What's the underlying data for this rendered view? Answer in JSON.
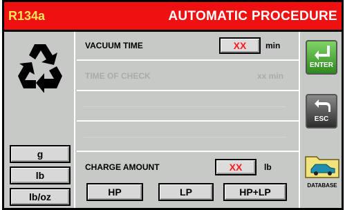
{
  "header": {
    "refrigerant": "R134a",
    "title": "AUTOMATIC PROCEDURE"
  },
  "units": [
    "g",
    "lb",
    "lb/oz"
  ],
  "rows": {
    "vacuum": {
      "label": "VACUUM TIME",
      "value": "XX",
      "unit": "min"
    },
    "check": {
      "label": "TIME OF CHECK",
      "value": "xx min"
    },
    "charge": {
      "label": "CHARGE AMOUNT",
      "value": "XX",
      "unit": "lb"
    }
  },
  "modes": [
    "HP",
    "LP",
    "HP+LP"
  ],
  "side": {
    "enter": "ENTER",
    "esc": "ESC",
    "database": "DATABASE"
  },
  "colors": {
    "header_bg": "#ef1111",
    "refrigerant_text": "#ffe25a",
    "value_text": "#ff1a1a",
    "panel_bg": "#c7c9c7"
  }
}
